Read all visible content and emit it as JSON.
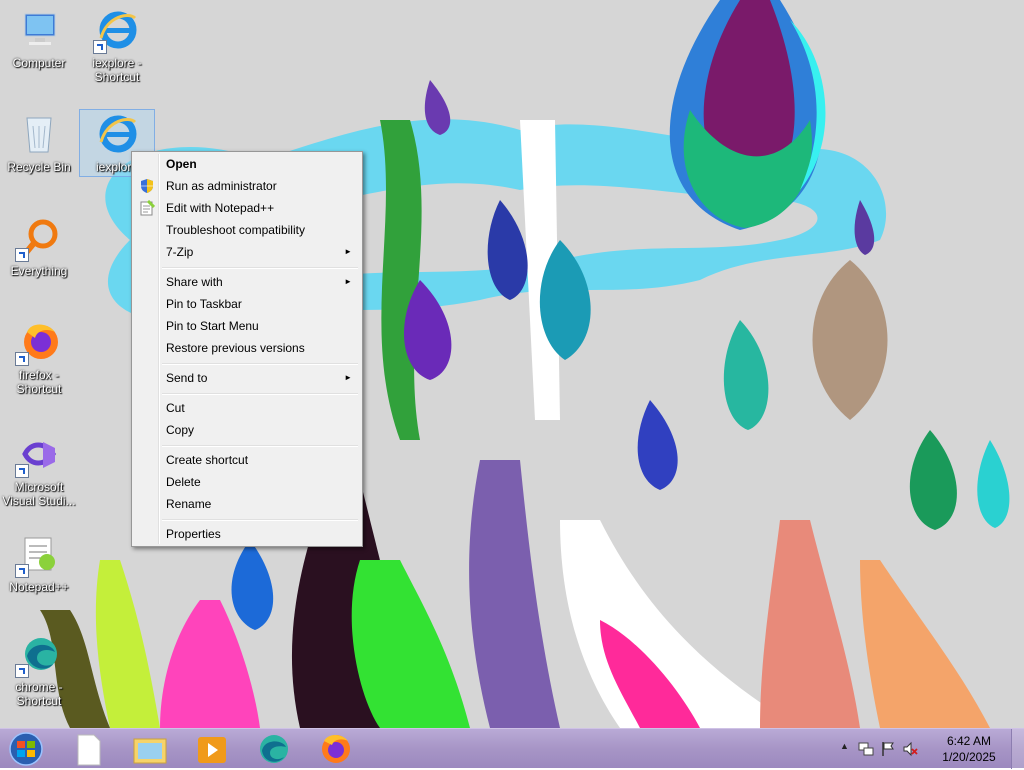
{
  "desktop": {
    "icons": [
      {
        "label": "Computer"
      },
      {
        "label": "iexplore - Shortcut"
      },
      {
        "label": "Recycle Bin"
      },
      {
        "label": "iexplore"
      },
      {
        "label": "Everything"
      },
      {
        "label": "firefox - Shortcut"
      },
      {
        "label": "Microsoft Visual Studi..."
      },
      {
        "label": "Notepad++"
      },
      {
        "label": "chrome - Shortcut"
      }
    ]
  },
  "context_menu": {
    "items": [
      {
        "label": "Open",
        "bold": true
      },
      {
        "label": "Run as administrator",
        "icon": "uac-shield-icon"
      },
      {
        "label": "Edit with Notepad++",
        "icon": "notepad-plus-plus-icon"
      },
      {
        "label": "Troubleshoot compatibility"
      },
      {
        "label": "7-Zip",
        "submenu": true
      },
      {
        "label": "Share with",
        "submenu": true
      },
      {
        "label": "Pin to Taskbar"
      },
      {
        "label": "Pin to Start Menu"
      },
      {
        "label": "Restore previous versions"
      },
      {
        "label": "Send to",
        "submenu": true
      },
      {
        "label": "Cut"
      },
      {
        "label": "Copy"
      },
      {
        "label": "Create shortcut"
      },
      {
        "label": "Delete"
      },
      {
        "label": "Rename"
      },
      {
        "label": "Properties"
      }
    ],
    "submenu_arrow": "►"
  },
  "taskbar": {
    "buttons": [
      "start-orb-icon",
      "file-icon",
      "explorer-folder-icon",
      "media-player-icon",
      "edge-chromium-icon",
      "firefox-icon"
    ],
    "tray": {
      "show_hidden_arrow": "▲",
      "time": "6:42 AM",
      "date": "1/20/2025"
    }
  },
  "colors": {
    "taskbar": "#a795c6",
    "menu_bg": "#f0f0f0",
    "wallpaper_bg": "#d8d8d8"
  }
}
